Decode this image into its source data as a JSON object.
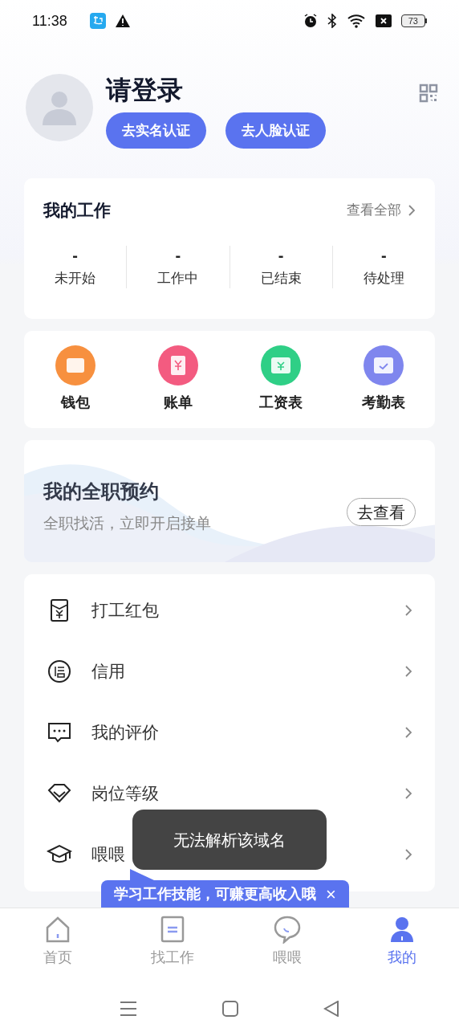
{
  "status_bar": {
    "time": "11:38",
    "battery": "73"
  },
  "profile": {
    "title": "请登录",
    "buttons": [
      "去实名认证",
      "去人脸认证"
    ]
  },
  "my_work": {
    "title": "我的工作",
    "link": "查看全部",
    "stats": [
      {
        "value": "-",
        "label": "未开始"
      },
      {
        "value": "-",
        "label": "工作中"
      },
      {
        "value": "-",
        "label": "已结束"
      },
      {
        "value": "-",
        "label": "待处理"
      }
    ]
  },
  "tools": [
    {
      "label": "钱包",
      "color": "#f7903f"
    },
    {
      "label": "账单",
      "color": "#f35b80"
    },
    {
      "label": "工资表",
      "color": "#2fcf86"
    },
    {
      "label": "考勤表",
      "color": "#7f86ee"
    }
  ],
  "banner": {
    "title": "我的全职预约",
    "subtitle": "全职找活，立即开启接单",
    "button": "去查看"
  },
  "menu": [
    {
      "label": "打工红包"
    },
    {
      "label": "信用"
    },
    {
      "label": "我的评价"
    },
    {
      "label": "岗位等级"
    },
    {
      "label": "喂喂"
    }
  ],
  "tip": {
    "text": "学习工作技能，可赚更高收入哦",
    "close": "×"
  },
  "toast": {
    "text": "无法解析该域名"
  },
  "tabs": [
    {
      "label": "首页",
      "selected": false
    },
    {
      "label": "找工作",
      "selected": false
    },
    {
      "label": "喂喂",
      "selected": false
    },
    {
      "label": "我的",
      "selected": true
    }
  ]
}
